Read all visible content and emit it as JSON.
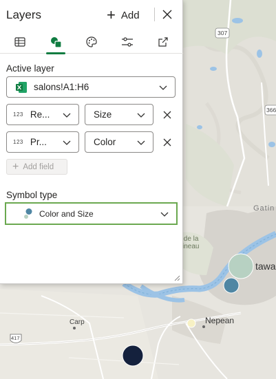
{
  "panel": {
    "title": "Layers",
    "add_label": "Add",
    "tabs": [
      {
        "name": "table",
        "icon": "table-icon",
        "active": false
      },
      {
        "name": "shapes",
        "icon": "shapes-icon",
        "active": true
      },
      {
        "name": "style",
        "icon": "palette-icon",
        "active": false
      },
      {
        "name": "settings",
        "icon": "sliders-icon",
        "active": false
      },
      {
        "name": "share",
        "icon": "share-icon",
        "active": false
      }
    ],
    "active_layer_label": "Active layer",
    "active_layer_value": "salons!A1:H6",
    "fields": [
      {
        "type_badge": "123",
        "column": "Re...",
        "role": "Size"
      },
      {
        "type_badge": "123",
        "column": "Pr...",
        "role": "Color"
      }
    ],
    "add_field_label": "Add field",
    "symbol_type_label": "Symbol type",
    "symbol_type_value": "Color and Size"
  },
  "map": {
    "labels": {
      "carp": "Carp",
      "nepean": "Nepean",
      "ottawa": "tawa",
      "gatineau_top": "Gatin",
      "gatineau_park_1": "c de la",
      "gatineau_park_2": "ineau",
      "route_307": "307",
      "route_366": "366",
      "route_417": "417"
    }
  },
  "colors": {
    "accent": "#107c41",
    "highlight_border": "#6aa84f",
    "map_water": "#9cc3e6",
    "bubble_navy": "#14213d",
    "bubble_teal": "#4f86a3",
    "bubble_sage": "#b7d1c2",
    "bubble_cream": "#f7f1c4"
  }
}
